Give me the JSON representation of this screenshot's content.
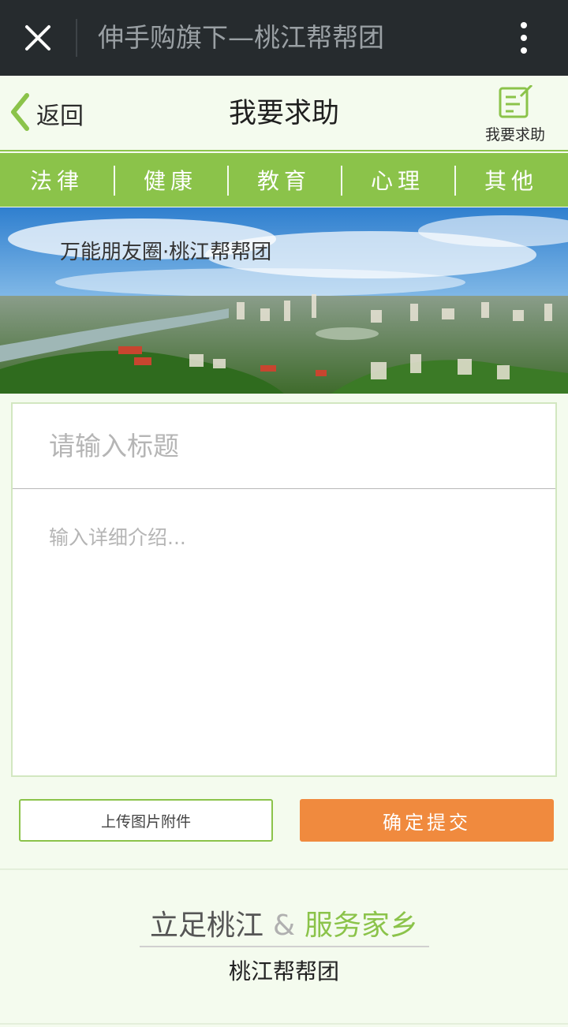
{
  "titlebar": {
    "title": "伸手购旗下—桃江帮帮团",
    "close_icon": "close-icon",
    "more_icon": "more-vertical-icon"
  },
  "navbar": {
    "back_label": "返回",
    "page_title": "我要求助",
    "ask_label": "我要求助"
  },
  "tabs": [
    "法律",
    "健康",
    "教育",
    "心理",
    "其他"
  ],
  "banner": {
    "caption": "万能朋友圈·桃江帮帮团"
  },
  "form": {
    "title_placeholder": "请输入标题",
    "detail_placeholder": "输入详细介绍..."
  },
  "buttons": {
    "upload": "上传图片附件",
    "submit": "确定提交"
  },
  "footer": {
    "slogan_left": "立足桃江",
    "slogan_amp": "&",
    "slogan_right": "服务家乡",
    "org_name": "桃江帮帮团"
  },
  "colors": {
    "accent_green": "#8bc34a",
    "submit_orange": "#f08a3e",
    "titlebar_dark": "#262b2e"
  }
}
